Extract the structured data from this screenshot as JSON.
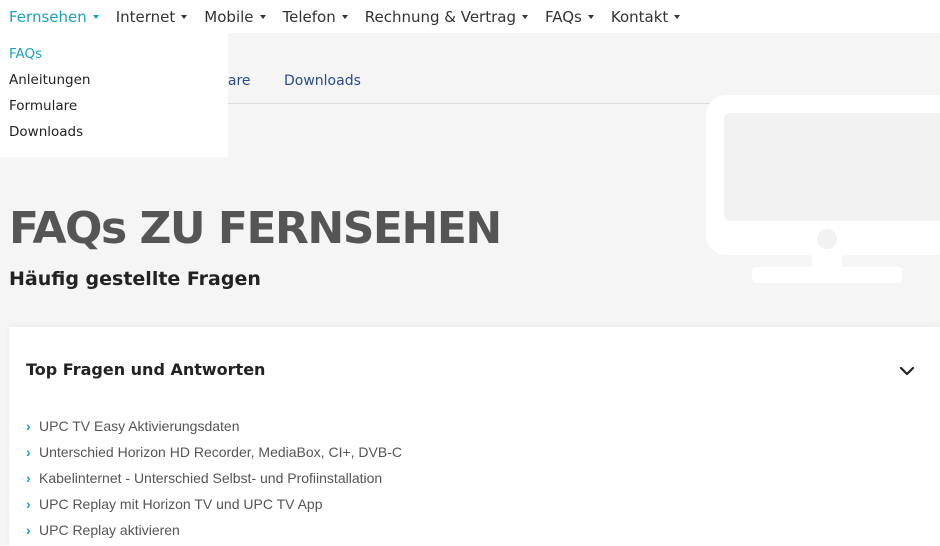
{
  "topnav": {
    "items": [
      {
        "label": "Fernsehen"
      },
      {
        "label": "Internet"
      },
      {
        "label": "Mobile"
      },
      {
        "label": "Telefon"
      },
      {
        "label": "Rechnung & Vertrag"
      },
      {
        "label": "FAQs"
      },
      {
        "label": "Kontakt"
      }
    ]
  },
  "dropdown": {
    "items": [
      {
        "label": "FAQs"
      },
      {
        "label": "Anleitungen"
      },
      {
        "label": "Formulare"
      },
      {
        "label": "Downloads"
      }
    ]
  },
  "subnav": {
    "partial_label": "lare",
    "downloads_label": "Downloads"
  },
  "hero": {
    "title": "FAQs ZU FERNSEHEN",
    "subtitle": "Häufig gestellte Fragen"
  },
  "faq_card": {
    "title": "Top Fragen und Antworten",
    "questions": [
      "UPC TV Easy Aktivierungsdaten",
      "Unterschied Horizon HD Recorder, MediaBox, CI+, DVB-C",
      "Kabelinternet - Unterschied Selbst- und Profiinstallation",
      "UPC Replay mit Horizon TV und UPC TV App",
      "UPC Replay aktivieren"
    ]
  },
  "colors": {
    "accent": "#1aa0c7",
    "link": "#2a4b8d",
    "page_bg": "#f5f5f5"
  }
}
